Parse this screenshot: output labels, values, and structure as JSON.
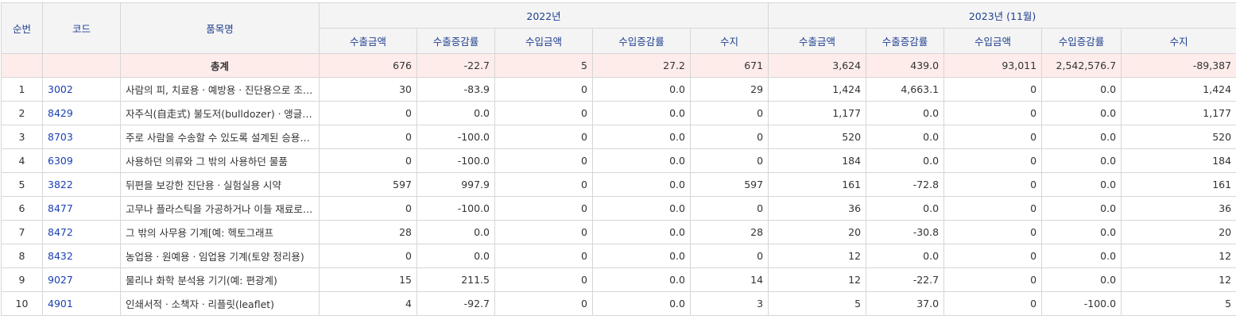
{
  "headers": {
    "rank": "순번",
    "code": "코드",
    "item_name": "품목명",
    "period1": "2022년",
    "period2": "2023년 (11월)",
    "export_amount": "수출금액",
    "export_change": "수출증감률",
    "import_amount": "수입금액",
    "import_change": "수입증감률",
    "balance": "수지"
  },
  "total": {
    "label": "총계",
    "p1": [
      "676",
      "-22.7",
      "5",
      "27.2",
      "671"
    ],
    "p2": [
      "3,624",
      "439.0",
      "93,011",
      "2,542,576.7",
      "-89,387"
    ]
  },
  "rows": [
    {
      "rank": "1",
      "code": "3002",
      "name": "사람의 피, 치료용ㆍ예방용ㆍ진단용으로 조제한 동물의 피",
      "p1": [
        "30",
        "-83.9",
        "0",
        "0.0",
        "29"
      ],
      "p2": [
        "1,424",
        "4,663.1",
        "0",
        "0.0",
        "1,424"
      ]
    },
    {
      "rank": "2",
      "code": "8429",
      "name": "자주식(自走式) 불도저(bulldozer)ㆍ앵글도저",
      "p1": [
        "0",
        "0.0",
        "0",
        "0.0",
        "0"
      ],
      "p2": [
        "1,177",
        "0.0",
        "0",
        "0.0",
        "1,177"
      ]
    },
    {
      "rank": "3",
      "code": "8703",
      "name": "주로 사람을 수송할 수 있도록 설계된 승용자동차",
      "p1": [
        "0",
        "-100.0",
        "0",
        "0.0",
        "0"
      ],
      "p2": [
        "520",
        "0.0",
        "0",
        "0.0",
        "520"
      ]
    },
    {
      "rank": "4",
      "code": "6309",
      "name": "사용하던 의류와 그 밖의 사용하던 물품",
      "p1": [
        "0",
        "-100.0",
        "0",
        "0.0",
        "0"
      ],
      "p2": [
        "184",
        "0.0",
        "0",
        "0.0",
        "184"
      ]
    },
    {
      "rank": "5",
      "code": "3822",
      "name": "뒤편을 보강한 진단용ㆍ실험실용 시약",
      "p1": [
        "597",
        "997.9",
        "0",
        "0.0",
        "597"
      ],
      "p2": [
        "161",
        "-72.8",
        "0",
        "0.0",
        "161"
      ]
    },
    {
      "rank": "6",
      "code": "8477",
      "name": "고무나 플라스틱을 가공하거나 이들 재료로 물품을 제조하는 기계",
      "p1": [
        "0",
        "-100.0",
        "0",
        "0.0",
        "0"
      ],
      "p2": [
        "36",
        "0.0",
        "0",
        "0.0",
        "36"
      ]
    },
    {
      "rank": "7",
      "code": "8472",
      "name": "그 밖의 사무용 기계[예: 헥토그래프",
      "p1": [
        "28",
        "0.0",
        "0",
        "0.0",
        "28"
      ],
      "p2": [
        "20",
        "-30.8",
        "0",
        "0.0",
        "20"
      ]
    },
    {
      "rank": "8",
      "code": "8432",
      "name": "농업용ㆍ원예용ㆍ임업용 기계(토양 정리용)",
      "p1": [
        "0",
        "0.0",
        "0",
        "0.0",
        "0"
      ],
      "p2": [
        "12",
        "0.0",
        "0",
        "0.0",
        "12"
      ]
    },
    {
      "rank": "9",
      "code": "9027",
      "name": "물리나 화학 분석용 기기(예: 편광계)",
      "p1": [
        "15",
        "211.5",
        "0",
        "0.0",
        "14"
      ],
      "p2": [
        "12",
        "-22.7",
        "0",
        "0.0",
        "12"
      ]
    },
    {
      "rank": "10",
      "code": "4901",
      "name": "인쇄서적ㆍ소책자ㆍ리플릿(leaflet)",
      "p1": [
        "4",
        "-92.7",
        "0",
        "0.0",
        "3"
      ],
      "p2": [
        "5",
        "37.0",
        "0",
        "-100.0",
        "5"
      ]
    }
  ]
}
